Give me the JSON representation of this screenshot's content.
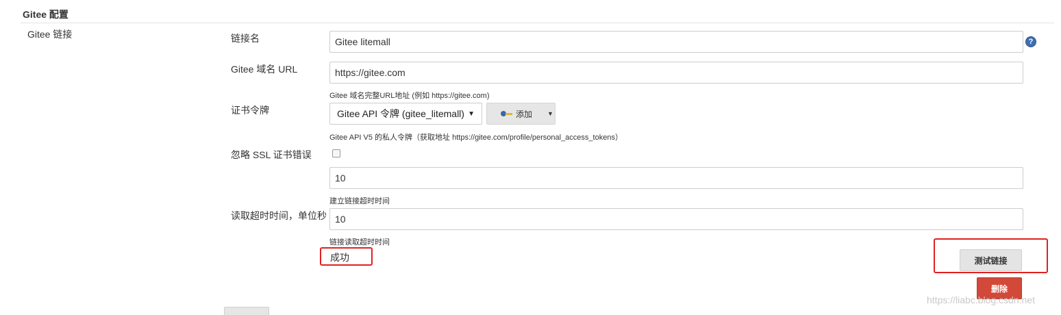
{
  "section": {
    "title": "Gitee 配置",
    "block_label": "Gitee 链接"
  },
  "fields": {
    "connection_name": {
      "label": "链接名",
      "value": "Gitee litemall"
    },
    "domain_url": {
      "label": "Gitee 域名 URL",
      "value": "https://gitee.com",
      "help": "Gitee 域名完整URL地址 (例如 https://gitee.com)"
    },
    "credential": {
      "label": "证书令牌",
      "selected": "Gitee API 令牌 (gitee_litemall)",
      "add_label": "添加",
      "help": "Gitee API V5 的私人令牌（获取地址 https://gitee.com/profile/personal_access_tokens）"
    },
    "ignore_ssl": {
      "label": "忽略 SSL 证书错误",
      "checked": false
    },
    "connect_timeout": {
      "value": "10",
      "help": "建立链接超时时间"
    },
    "read_timeout": {
      "label": "读取超时时间，单位秒",
      "value": "10",
      "help": "链接读取超时时间"
    }
  },
  "status": {
    "text": "成功"
  },
  "buttons": {
    "test": "测试链接",
    "delete": "删除"
  },
  "icons": {
    "help": "help-icon",
    "key": "key-icon"
  },
  "colors": {
    "delete_bg": "#d24939",
    "highlight_border": "#e02020",
    "help_icon": "#3e6fb0"
  },
  "watermark": "https://liabc.blog.csdn.net"
}
